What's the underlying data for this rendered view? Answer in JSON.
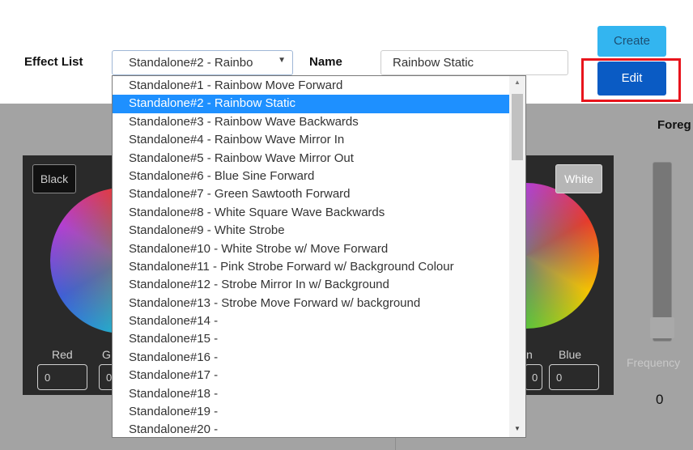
{
  "toolbar": {
    "effect_list_label": "Effect List",
    "effect_select_value": "Standalone#2 - Rainbo",
    "name_label": "Name",
    "name_value": "Rainbow Static",
    "create_label": "Create",
    "edit_label": "Edit"
  },
  "color_panel": {
    "black_label": "Black",
    "white_label": "White",
    "red_label": "Red",
    "g_label": "G",
    "n_label": "n",
    "blue_label": "Blue",
    "red_value": "0",
    "g_value": "0",
    "n_value": "0",
    "blue_value": "0"
  },
  "side_panel": {
    "foreground_label": "Foreg",
    "frequency_label": "Frequency",
    "frequency_value": "0"
  },
  "dropdown": {
    "selected_index": 1,
    "items": [
      "Standalone#1 - Rainbow Move Forward",
      "Standalone#2 - Rainbow Static",
      "Standalone#3 - Rainbow Wave Backwards",
      "Standalone#4 - Rainbow Wave Mirror In",
      "Standalone#5 - Rainbow Wave Mirror Out",
      "Standalone#6 - Blue Sine Forward",
      "Standalone#7 - Green Sawtooth Forward",
      "Standalone#8 - White Square Wave Backwards",
      "Standalone#9 - White Strobe",
      "Standalone#10 - White Strobe w/ Move Forward",
      "Standalone#11 - Pink Strobe Forward w/ Background Colour",
      "Standalone#12 - Strobe Mirror In w/ Background",
      "Standalone#13 - Strobe Move Forward w/ background",
      "Standalone#14 -",
      "Standalone#15 -",
      "Standalone#16 -",
      "Standalone#17 -",
      "Standalone#18 -",
      "Standalone#19 -",
      "Standalone#20 -"
    ]
  },
  "colors": {
    "accent_selected": "#1e90ff",
    "create_button": "#33b5f0",
    "edit_button": "#0a5bc4",
    "highlight_border": "#e8141c"
  }
}
